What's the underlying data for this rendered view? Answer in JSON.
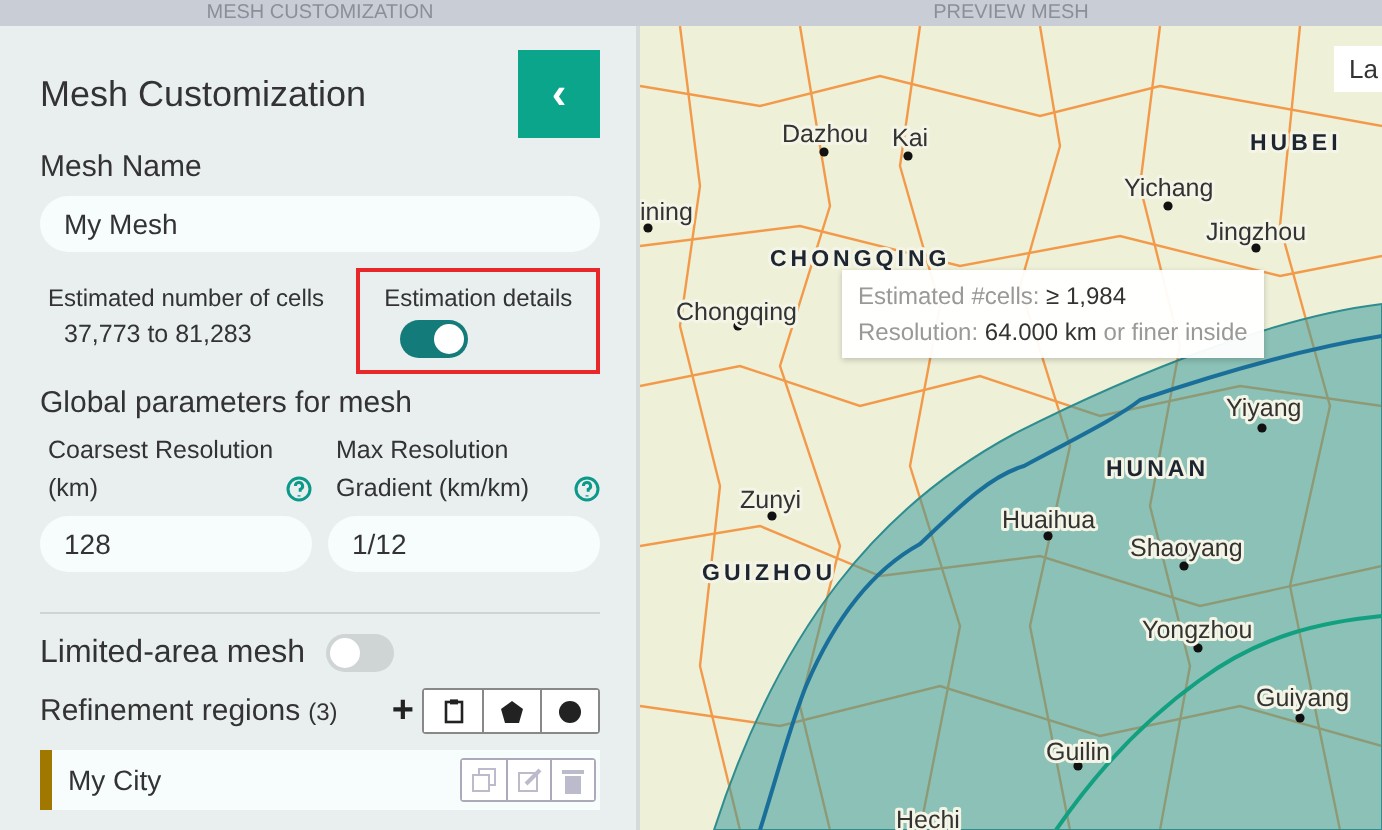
{
  "header_tabs": [
    {
      "label": "MESH CUSTOMIZATION"
    },
    {
      "label": "PREVIEW MESH"
    }
  ],
  "panel": {
    "title": "Mesh Customization",
    "back_button": "‹",
    "mesh_name": {
      "label": "Mesh Name",
      "value": "My Mesh"
    },
    "estimate": {
      "label": "Estimated number of cells",
      "value": "37,773 to 81,283"
    },
    "estimation_details": {
      "label": "Estimation details",
      "on": true,
      "highlighted": true
    },
    "global_heading": "Global parameters for mesh",
    "fields": [
      {
        "label": "Coarsest Resolution (km)",
        "value": "128"
      },
      {
        "label": "Max Resolution Gradient (km/km)",
        "value": "1/12"
      }
    ],
    "limited_area": {
      "label": "Limited-area mesh",
      "on": false
    },
    "refinement": {
      "label": "Refinement regions",
      "count": "(3)",
      "add": "+"
    },
    "regions": [
      {
        "name": "My City",
        "color": "#a07800"
      }
    ]
  },
  "map": {
    "layer_button": "La",
    "labels": [
      {
        "text": "Dazhou",
        "kind": "city"
      },
      {
        "text": "Kai",
        "kind": "city"
      },
      {
        "text": "ining",
        "kind": "city"
      },
      {
        "text": "CHONGQING",
        "kind": "province"
      },
      {
        "text": "Chongqing",
        "kind": "city"
      },
      {
        "text": "HUBEI",
        "kind": "province"
      },
      {
        "text": "Yichang",
        "kind": "city"
      },
      {
        "text": "Jingzhou",
        "kind": "city"
      },
      {
        "text": "Yiyang",
        "kind": "city"
      },
      {
        "text": "HUNAN",
        "kind": "province"
      },
      {
        "text": "Huaihua",
        "kind": "city"
      },
      {
        "text": "Shaoyang",
        "kind": "city"
      },
      {
        "text": "Yongzhou",
        "kind": "city"
      },
      {
        "text": "Guiyang",
        "kind": "city"
      },
      {
        "text": "Zunyi",
        "kind": "city"
      },
      {
        "text": "GUIZHOU",
        "kind": "province"
      },
      {
        "text": "Guilin",
        "kind": "city"
      },
      {
        "text": "Hechi",
        "kind": "city"
      }
    ],
    "tooltip": [
      {
        "label": "Estimated #cells:",
        "value": "≥ 1,984"
      },
      {
        "label": "Resolution:",
        "value": "64.000 km",
        "suffix": "or finer inside"
      }
    ]
  }
}
